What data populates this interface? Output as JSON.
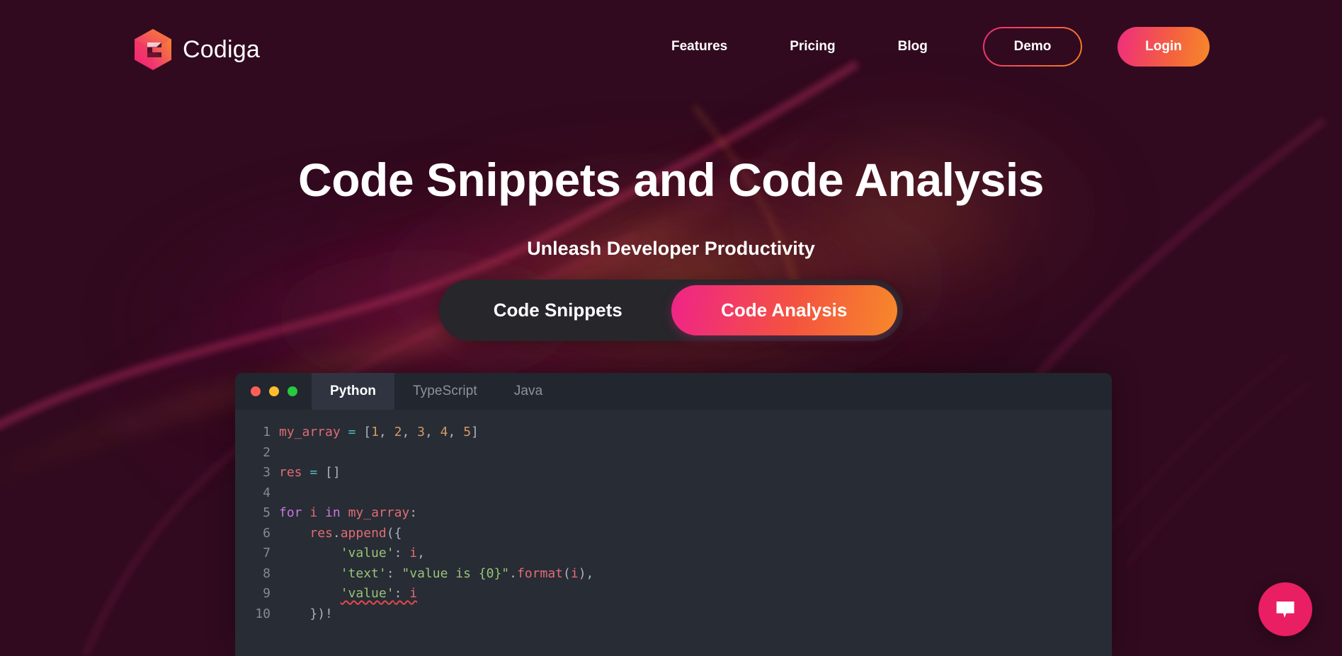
{
  "brand": {
    "name": "Codiga",
    "logo_icon": "codiga-cube-logo",
    "gradient_start": "#ee2a7b",
    "gradient_end": "#f58220"
  },
  "nav": {
    "links": [
      {
        "label": "Features"
      },
      {
        "label": "Pricing"
      },
      {
        "label": "Blog"
      }
    ],
    "demo_label": "Demo",
    "login_label": "Login"
  },
  "hero": {
    "title": "Code Snippets and Code Analysis",
    "subtitle": "Unleash Developer Productivity"
  },
  "toggle": {
    "options": [
      {
        "label": "Code Snippets",
        "active": false
      },
      {
        "label": "Code Analysis",
        "active": true
      }
    ],
    "active_gradient_start": "#ef2488",
    "active_gradient_end": "#f7892a"
  },
  "editor": {
    "window_dots": [
      "red",
      "yellow",
      "green"
    ],
    "tabs": [
      {
        "label": "Python",
        "active": true
      },
      {
        "label": "TypeScript",
        "active": false
      },
      {
        "label": "Java",
        "active": false
      }
    ],
    "language": "Python",
    "background": "#282c34",
    "lines": [
      {
        "number": "1",
        "text": "my_array = [1, 2, 3, 4, 5]"
      },
      {
        "number": "2",
        "text": ""
      },
      {
        "number": "3",
        "text": "res = []"
      },
      {
        "number": "4",
        "text": ""
      },
      {
        "number": "5",
        "text": "for i in my_array:"
      },
      {
        "number": "6",
        "text": "    res.append({"
      },
      {
        "number": "7",
        "text": "        'value': i,"
      },
      {
        "number": "8",
        "text": "        'text': \"value is {0}\".format(i),"
      },
      {
        "number": "9",
        "text": "        'value': i",
        "error": true
      },
      {
        "number": "10",
        "text": "    })!"
      }
    ]
  },
  "chat": {
    "icon": "chat-bubble-icon",
    "color": "#e91e63"
  }
}
